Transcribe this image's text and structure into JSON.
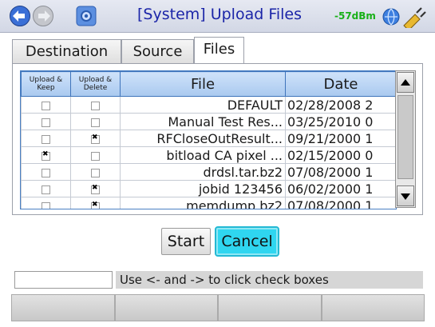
{
  "titlebar": {
    "title": "[System] Upload Files",
    "signal": "-57dBm",
    "icons": [
      "back-arrow-icon",
      "forward-arrow-icon",
      "system-settings-icon",
      "network-globe-icon",
      "power-plug-icon"
    ],
    "signal_color": "#18b018",
    "title_color": "#1b25a8"
  },
  "tabs": [
    {
      "label": "Destination",
      "active": false
    },
    {
      "label": "Source",
      "active": false
    },
    {
      "label": "Files",
      "active": true
    }
  ],
  "table": {
    "headers": {
      "keep": "Upload & Keep",
      "delete": "Upload & Delete",
      "file": "File",
      "date": "Date"
    },
    "rows": [
      {
        "keep": false,
        "delete": false,
        "file": "DEFAULT",
        "date": "02/28/2008 2"
      },
      {
        "keep": false,
        "delete": false,
        "file": "Manual Test Res...",
        "date": "03/25/2010 0"
      },
      {
        "keep": false,
        "delete": true,
        "file": "RFCloseOutResult...",
        "date": "09/21/2000 1"
      },
      {
        "keep": true,
        "delete": false,
        "file": "bitload CA pixel ...",
        "date": "02/15/2000 0"
      },
      {
        "keep": false,
        "delete": false,
        "file": "drdsl.tar.bz2",
        "date": "07/08/2000 1"
      },
      {
        "keep": false,
        "delete": true,
        "file": "jobid 123456",
        "date": "06/02/2000 1"
      },
      {
        "keep": false,
        "delete": true,
        "file": "memdump.bz2",
        "date": "07/08/2000 1"
      }
    ]
  },
  "buttons": {
    "start": "Start",
    "cancel": "Cancel"
  },
  "status": {
    "input_value": "",
    "hint": "Use <- and -> to click check boxes"
  },
  "softkeys": [
    "",
    "",
    "",
    ""
  ]
}
